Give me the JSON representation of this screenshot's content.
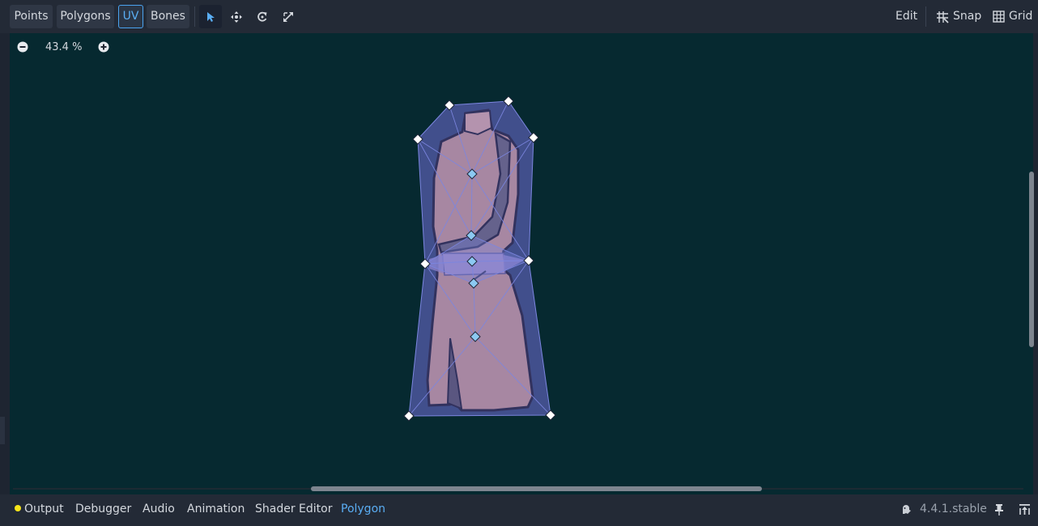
{
  "toolbar": {
    "mode_buttons": [
      "Points",
      "Polygons",
      "UV",
      "Bones"
    ],
    "active_mode": "UV",
    "tools": [
      "select-icon",
      "move-icon",
      "rotate-icon",
      "scale-icon"
    ],
    "active_tool": "select-icon",
    "edit_label": "Edit",
    "snap_label": "Snap",
    "grid_label": "Grid"
  },
  "viewport": {
    "zoom": "43.4 %"
  },
  "bottom_panel": {
    "tabs": [
      "Output",
      "Debugger",
      "Audio",
      "Animation",
      "Shader Editor",
      "Polygon"
    ],
    "active_tab": "Polygon",
    "version": "4.4.1.stable"
  },
  "colors": {
    "accent": "#5aaef4",
    "viewport_bg": "#062930",
    "polygon_fill": "#4a5499",
    "output_dot": "#f7e51a"
  }
}
